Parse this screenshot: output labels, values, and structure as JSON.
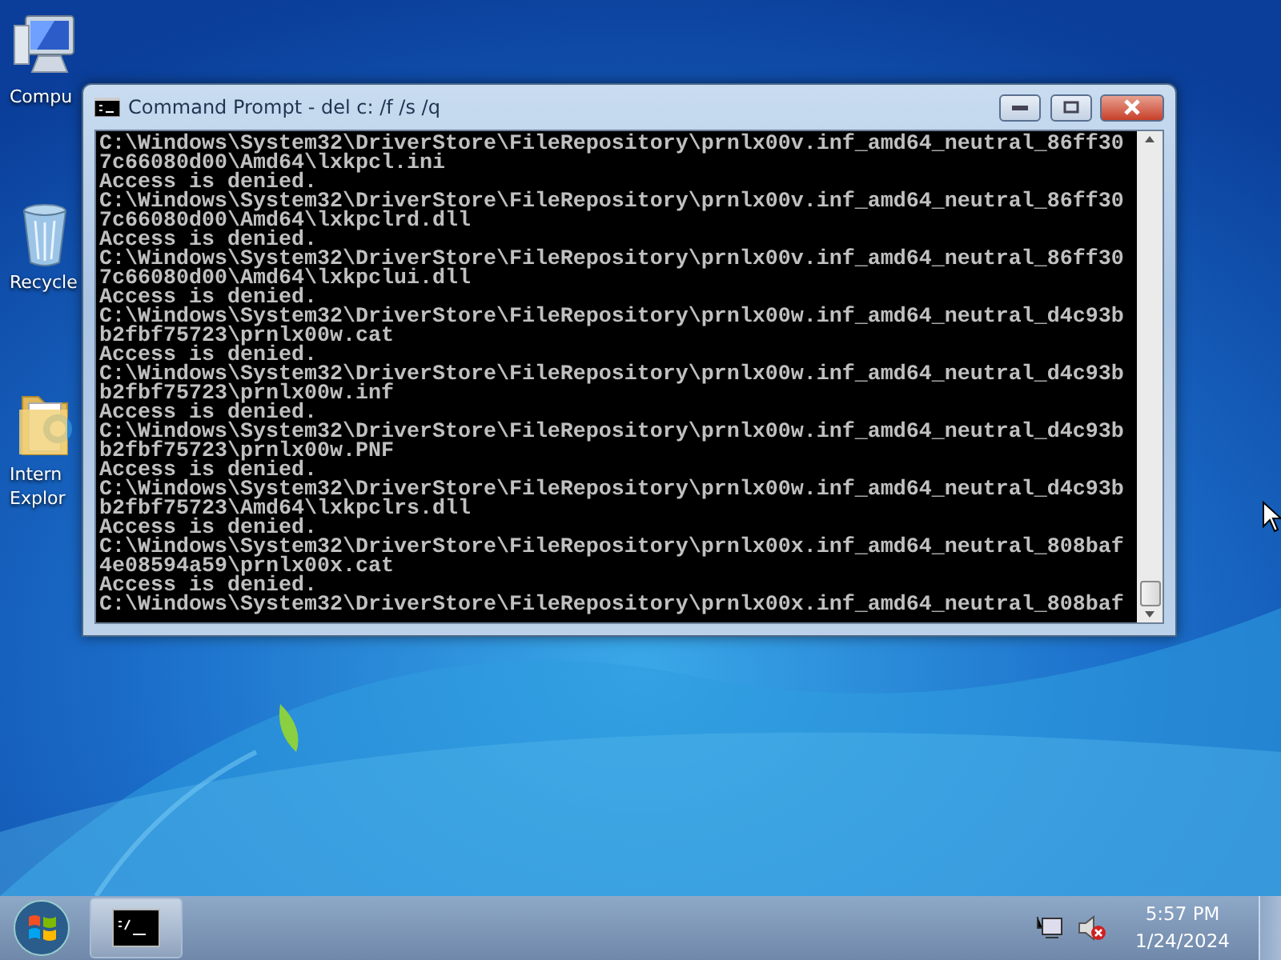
{
  "desktop_icons": [
    {
      "kind": "computer",
      "lines": [
        "Compu"
      ]
    },
    {
      "kind": "recycle-bin",
      "lines": [
        "Recycle"
      ]
    },
    {
      "kind": "folder",
      "lines": [
        "Intern",
        "Explor"
      ]
    }
  ],
  "window": {
    "title": "Command Prompt - del  c: /f /s /q",
    "console_lines": [
      "C:\\Windows\\System32\\DriverStore\\FileRepository\\prnlx00v.inf_amd64_neutral_86ff30",
      "7c66080d00\\Amd64\\lxkpcl.ini",
      "Access is denied.",
      "C:\\Windows\\System32\\DriverStore\\FileRepository\\prnlx00v.inf_amd64_neutral_86ff30",
      "7c66080d00\\Amd64\\lxkpclrd.dll",
      "Access is denied.",
      "C:\\Windows\\System32\\DriverStore\\FileRepository\\prnlx00v.inf_amd64_neutral_86ff30",
      "7c66080d00\\Amd64\\lxkpclui.dll",
      "Access is denied.",
      "C:\\Windows\\System32\\DriverStore\\FileRepository\\prnlx00w.inf_amd64_neutral_d4c93b",
      "b2fbf75723\\prnlx00w.cat",
      "Access is denied.",
      "C:\\Windows\\System32\\DriverStore\\FileRepository\\prnlx00w.inf_amd64_neutral_d4c93b",
      "b2fbf75723\\prnlx00w.inf",
      "Access is denied.",
      "C:\\Windows\\System32\\DriverStore\\FileRepository\\prnlx00w.inf_amd64_neutral_d4c93b",
      "b2fbf75723\\prnlx00w.PNF",
      "Access is denied.",
      "C:\\Windows\\System32\\DriverStore\\FileRepository\\prnlx00w.inf_amd64_neutral_d4c93b",
      "b2fbf75723\\Amd64\\lxkpclrs.dll",
      "Access is denied.",
      "C:\\Windows\\System32\\DriverStore\\FileRepository\\prnlx00x.inf_amd64_neutral_808baf",
      "4e08594a59\\prnlx00x.cat",
      "Access is denied.",
      "C:\\Windows\\System32\\DriverStore\\FileRepository\\prnlx00x.inf_amd64_neutral_808baf"
    ]
  },
  "taskbar": {
    "clock": {
      "time": "5:57 PM",
      "date": "1/24/2024"
    }
  }
}
